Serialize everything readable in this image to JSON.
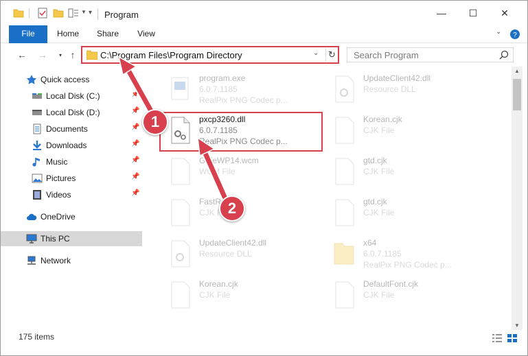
{
  "window": {
    "title": "Program",
    "controls": {
      "minimize": "—",
      "maximize": "☐",
      "close": "✕"
    }
  },
  "ribbon": {
    "tabs": [
      "File",
      "Home",
      "Share",
      "View"
    ]
  },
  "address": {
    "path": "C:\\Program Files\\Program Directory",
    "search_placeholder": "Search Program"
  },
  "sidebar": {
    "items": [
      {
        "label": "Quick access",
        "icon": "star-icon",
        "pinned": false
      },
      {
        "label": "Local Disk (C:)",
        "icon": "drive-icon",
        "pinned": true
      },
      {
        "label": "Local Disk (D:)",
        "icon": "drive-icon",
        "pinned": true
      },
      {
        "label": "Documents",
        "icon": "documents-icon",
        "pinned": true
      },
      {
        "label": "Downloads",
        "icon": "download-icon",
        "pinned": true
      },
      {
        "label": "Music",
        "icon": "music-icon",
        "pinned": true
      },
      {
        "label": "Pictures",
        "icon": "pictures-icon",
        "pinned": true
      },
      {
        "label": "Videos",
        "icon": "videos-icon",
        "pinned": true
      },
      {
        "label": "OneDrive",
        "icon": "cloud-icon",
        "pinned": false
      },
      {
        "label": "This PC",
        "icon": "computer-icon",
        "pinned": false,
        "selected": true
      },
      {
        "label": "Network",
        "icon": "network-icon",
        "pinned": false
      }
    ]
  },
  "files": [
    {
      "name": "program.exe",
      "line2": "6.0.7.1185",
      "line3": "RealPix PNG Codec p...",
      "faded": true
    },
    {
      "name": "UpdateClient42.dll",
      "line2": "Resource DLL",
      "line3": "",
      "faded": true
    },
    {
      "name": "pxcp3260.dll",
      "line2": "6.0.7.1185",
      "line3": "RealPix PNG Codec p...",
      "faded": false,
      "highlighted": true
    },
    {
      "name": "Korean.cjk",
      "line2": "CJK File",
      "line3": "",
      "faded": true
    },
    {
      "name": "GdfeWP14.wcm",
      "line2": "WCM File",
      "line3": "",
      "faded": true
    },
    {
      "name": "gtd.cjk",
      "line2": "CJK File",
      "line3": "",
      "faded": true
    },
    {
      "name": "FastRes.cjk",
      "line2": "CJK File",
      "line3": "",
      "faded": true
    },
    {
      "name": "gtd.cjk",
      "line2": "CJK File",
      "line3": "",
      "faded": true
    },
    {
      "name": "UpdateClient42.dll",
      "line2": "Resource DLL",
      "line3": "",
      "faded": true
    },
    {
      "name": "x64",
      "line2": "6.0.7.1185",
      "line3": "RealPix PNG Codec p...",
      "faded": true
    },
    {
      "name": "Korean.cjk",
      "line2": "CJK File",
      "line3": "",
      "faded": true
    },
    {
      "name": "DefaultFont.cjk",
      "line2": "CJK File",
      "line3": "",
      "faded": true
    }
  ],
  "status": {
    "count": "175 items"
  },
  "annotations": {
    "badge1": "1",
    "badge2": "2"
  },
  "colors": {
    "accent": "#1a6fc6",
    "highlight": "#d8404e",
    "selected_bg": "#d8d8d8"
  }
}
